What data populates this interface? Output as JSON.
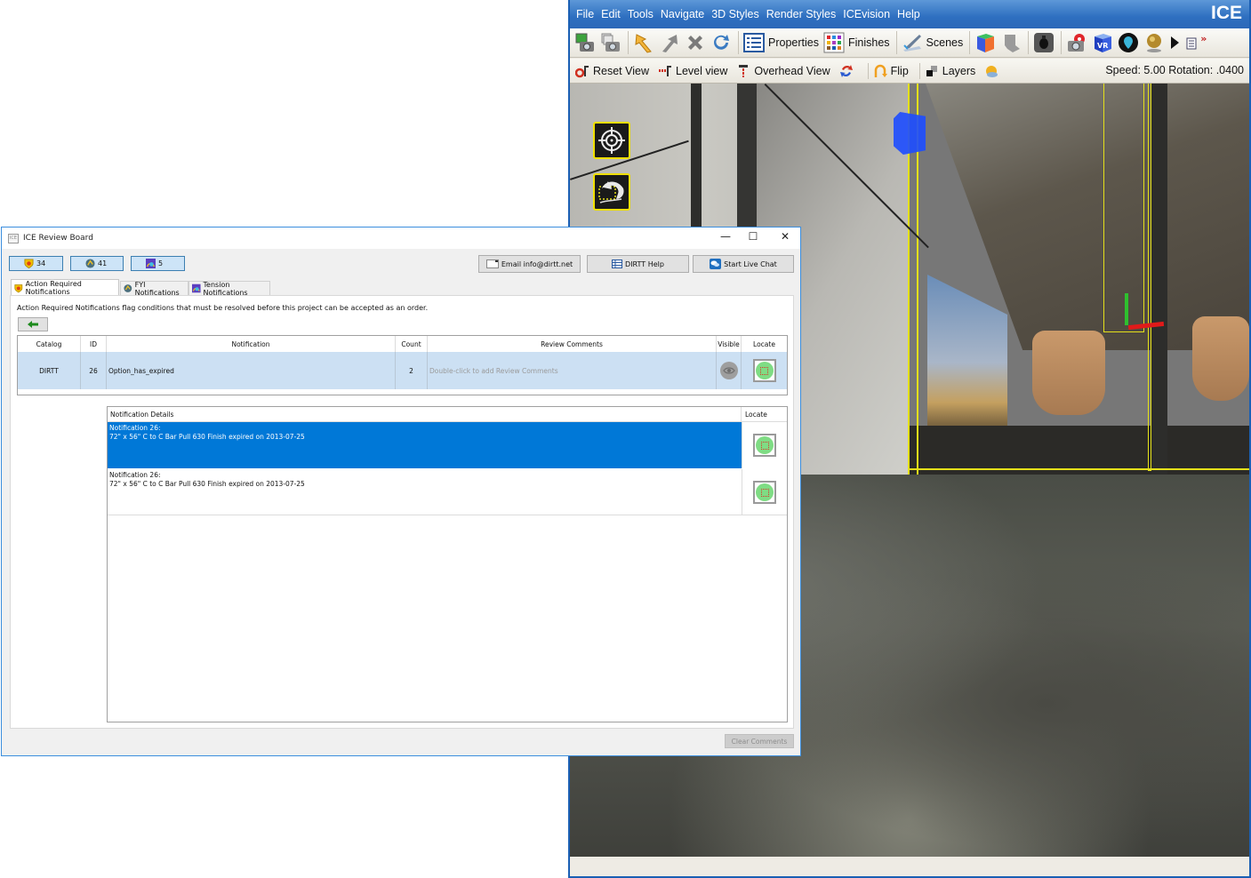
{
  "ice_window": {
    "logo": "ICE",
    "menu": [
      "File",
      "Edit",
      "Tools",
      "Navigate",
      "3D Styles",
      "Render Styles",
      "ICEvision",
      "Help"
    ],
    "toolbar": {
      "properties_label": "Properties",
      "finishes_label": "Finishes",
      "scenes_label": "Scenes"
    },
    "viewbar": {
      "reset_view": "Reset View",
      "level_view": "Level view",
      "overhead_view": "Overhead View",
      "flip": "Flip",
      "layers": "Layers",
      "speed_readout": "Speed: 5.00 Rotation: .0400"
    },
    "viewport_overlay_buttons": [
      "target-icon",
      "return-view-icon"
    ]
  },
  "review_board": {
    "title": "ICE Review Board",
    "app_icon_text": "ICE",
    "window_controls": {
      "minimize": "—",
      "maximize": "☐",
      "close": "✕"
    },
    "summary": [
      {
        "icon": "shield-icon",
        "count": "34"
      },
      {
        "icon": "fyi-globe-icon",
        "count": "41"
      },
      {
        "icon": "tension-icon",
        "count": "5"
      }
    ],
    "actions": {
      "email": "Email info@dirtt.net",
      "help": "DIRTT Help",
      "chat": "Start Live Chat"
    },
    "tabs": [
      {
        "label": "Action Required Notifications",
        "active": true
      },
      {
        "label": "FYI Notifications",
        "active": false
      },
      {
        "label": "Tension Notifications",
        "active": false
      }
    ],
    "description": "Action Required Notifications flag conditions that must be resolved before this project can be accepted as an order.",
    "table": {
      "columns": [
        "Catalog",
        "ID",
        "Notification",
        "Count",
        "Review Comments",
        "Visible",
        "Locate"
      ],
      "rows": [
        {
          "catalog": "DIRTT",
          "id": "26",
          "notification": "Option_has_expired",
          "count": "2",
          "review_comments_placeholder": "Double-click to add Review Comments"
        }
      ]
    },
    "details": {
      "columns": [
        "Notification Details",
        "Locate"
      ],
      "rows": [
        {
          "line1": "Notification 26:",
          "line2": "72\" x 56\" C to C Bar Pull 630 Finish expired on 2013-07-25",
          "selected": true
        },
        {
          "line1": "Notification 26:",
          "line2": "72\" x 56\" C to C Bar Pull 630 Finish expired on 2013-07-25",
          "selected": false
        }
      ]
    },
    "clear_comments": "Clear Comments"
  },
  "colors": {
    "ice_menubar": "#2e6fc0",
    "selection_blue": "#0078d7",
    "row_highlight": "#cce0f3",
    "locate_green": "#7fdc84",
    "overlay_yellow": "#f0e000"
  }
}
